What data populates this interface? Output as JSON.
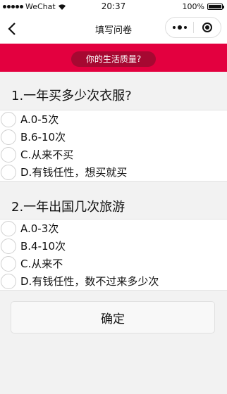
{
  "status_bar": {
    "carrier": "WeChat",
    "time": "20:37",
    "battery": "100%"
  },
  "nav": {
    "title": "填写问卷"
  },
  "banner": {
    "text": "你的生活质量?"
  },
  "questions": [
    {
      "title": "1.一年买多少次衣服?",
      "options": [
        "A.0-5次",
        "B.6-10次",
        "C.从来不买",
        "D.有钱任性，想买就买"
      ]
    },
    {
      "title": "2.一年出国几次旅游",
      "options": [
        "A.0-3次",
        "B.4-10次",
        "C.从来不",
        "D.有钱任性，数不过来多少次"
      ]
    }
  ],
  "submit": {
    "label": "确定"
  }
}
